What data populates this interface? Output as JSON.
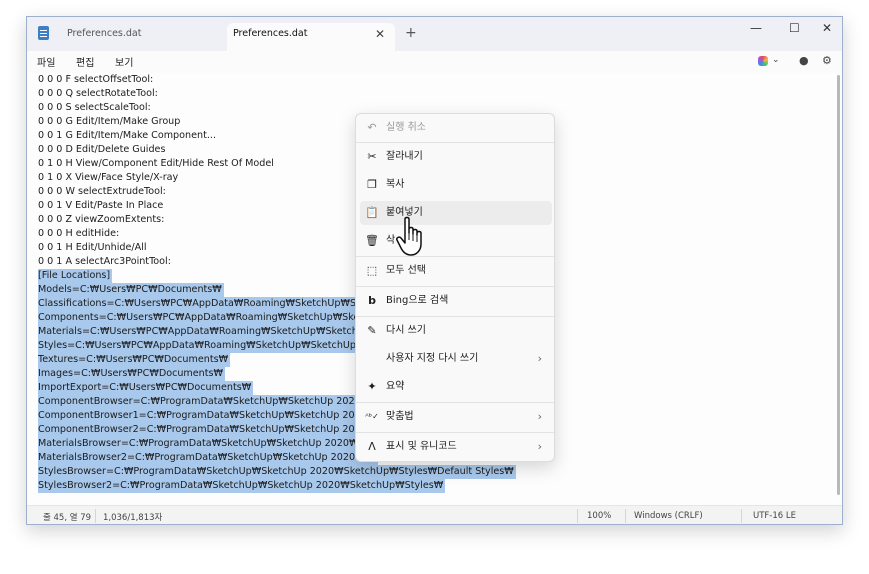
{
  "titlebar": {
    "tabs": [
      {
        "label": "Preferences.dat"
      },
      {
        "label": "Preferences.dat"
      }
    ],
    "close_tab_glyph": "✕",
    "new_tab_glyph": "+",
    "minimize_glyph": "—",
    "maximize_glyph": "☐",
    "close_glyph": "✕"
  },
  "menu": {
    "file": "파일",
    "edit": "편집",
    "view": "보기"
  },
  "editor": {
    "lines": [
      "0 0 0 F selectOffsetTool:",
      "0 0 0 Q selectRotateTool:",
      "0 0 0 S selectScaleTool:",
      "0 0 0 G Edit/Item/Make Group",
      "0 0 1 G Edit/Item/Make Component...",
      "0 0 0 D Edit/Delete Guides",
      "0 1 0 H View/Component Edit/Hide Rest Of Model",
      "0 1 0 X View/Face Style/X-ray",
      "0 0 0 W selectExtrudeTool:",
      "0 0 1 V Edit/Paste In Place",
      "0 0 0 Z viewZoomExtents:",
      "0 0 0 H editHide:",
      "0 0 1 H Edit/Unhide/All",
      "0 0 1 A selectArc3PointTool:"
    ],
    "selected_lines": [
      "[File Locations]",
      "Models=C:₩Users₩PC₩Documents₩",
      "Classifications=C:₩Users₩PC₩AppData₩Roaming₩SketchUp₩Sketc",
      "Components=C:₩Users₩PC₩AppData₩Roaming₩SketchUp₩Sketc",
      "Materials=C:₩Users₩PC₩AppData₩Roaming₩SketchUp₩SketchUp",
      "Styles=C:₩Users₩PC₩AppData₩Roaming₩SketchUp₩SketchUp 20",
      "Textures=C:₩Users₩PC₩Documents₩",
      "Images=C:₩Users₩PC₩Documents₩",
      "ImportExport=C:₩Users₩PC₩Documents₩",
      "ComponentBrowser=C:₩ProgramData₩SketchUp₩SketchUp 2020₩",
      "ComponentBrowser1=C:₩ProgramData₩SketchUp₩SketchUp 2020",
      "ComponentBrowser2=C:₩ProgramData₩SketchUp₩SketchUp 2020",
      "MaterialsBrowser=C:₩ProgramData₩SketchUp₩SketchUp 2020₩Sk",
      "MaterialsBrowser2=C:₩ProgramData₩SketchUp₩SketchUp 2020₩Sk",
      "StylesBrowser=C:₩ProgramData₩SketchUp₩SketchUp 2020₩SketchUp₩Styles₩Default Styles₩",
      "StylesBrowser2=C:₩ProgramData₩SketchUp₩SketchUp 2020₩SketchUp₩Styles₩"
    ]
  },
  "context_menu": {
    "undo": "실행 취소",
    "cut": "잘라내기",
    "copy": "복사",
    "paste": "붙여넣기",
    "delete": "삭",
    "select_all": "모두 선택",
    "bing_search": "Bing으로 검색",
    "rewrite": "다시 쓰기",
    "custom_rewrite": "사용자 지정 다시 쓰기",
    "summarize": "요약",
    "spelling": "맞춤법",
    "unicode": "표시 및 유니코드"
  },
  "statusbar": {
    "position": "줄 45, 열 79",
    "chars": "1,036/1,813자",
    "zoom": "100%",
    "line_ending": "Windows (CRLF)",
    "encoding": "UTF-16 LE"
  },
  "icons": [
    "notepad-icon",
    "copilot-icon",
    "account-icon",
    "settings-icon",
    "undo-icon",
    "scissors-icon",
    "copy-icon",
    "paste-icon",
    "trash-icon",
    "select-all-icon",
    "bing-icon",
    "rewrite-icon",
    "summarize-icon",
    "spelling-icon",
    "unicode-icon",
    "hand-cursor-icon"
  ]
}
